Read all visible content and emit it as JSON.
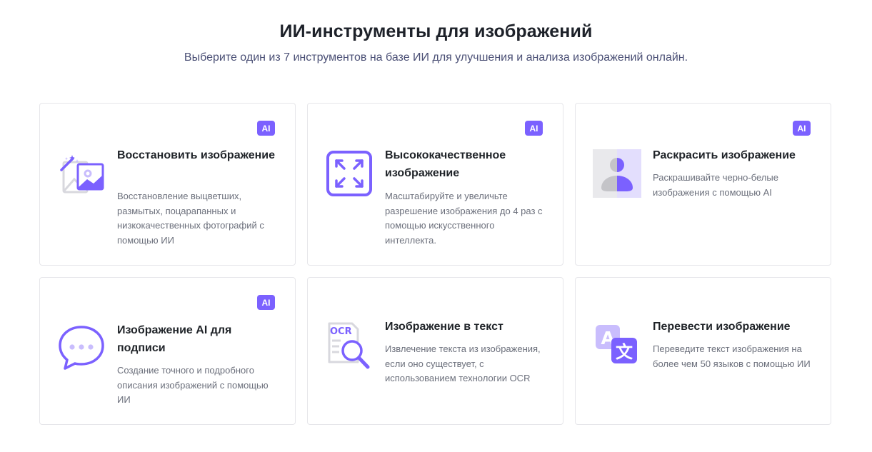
{
  "header": {
    "title": "ИИ-инструменты для изображений",
    "subtitle": "Выберите один из 7 инструментов на базе ИИ для улучшения и анализа изображений онлайн."
  },
  "cards": [
    {
      "title": "Восстановить изображение",
      "description": "Восстановление выцветших, размытых, поцарапанных и низкокачественных фотографий с помощью ИИ",
      "badge": "AI",
      "icon": "photo-restore-icon"
    },
    {
      "title": "Высококачественное изображение",
      "description": "Масштабируйте и увеличьте разрешение изображения до 4 раз с помощью искусственного интеллекта.",
      "badge": "AI",
      "icon": "upscale-icon"
    },
    {
      "title": "Раскрасить изображение",
      "description": "Раскрашивайте черно-белые изображения с помощью AI",
      "badge": "AI",
      "icon": "colorize-icon"
    },
    {
      "title": "Изображение AI для подписи",
      "description": "Создание точного и подробного описания изображений с помощью ИИ",
      "badge": "AI",
      "icon": "caption-icon"
    },
    {
      "title": "Изображение в текст",
      "description": "Извлечение текста из изображения, если оно существует, с использованием технологии OCR",
      "badge": "",
      "icon": "ocr-icon"
    },
    {
      "title": "Перевести изображение",
      "description": "Переведите текст изображения на более чем 50 языков с помощью ИИ",
      "badge": "",
      "icon": "translate-icon"
    }
  ],
  "colors": {
    "accent": "#7b61ff",
    "accent_light": "#c9bdfd",
    "title": "#1d2129",
    "subtitle": "#4a4f75",
    "body_text": "#6b6f7b",
    "border": "#e6e6ea"
  },
  "icons": {
    "ocr_label": "OCR",
    "translate_latin": "A",
    "translate_cjk": "文"
  }
}
